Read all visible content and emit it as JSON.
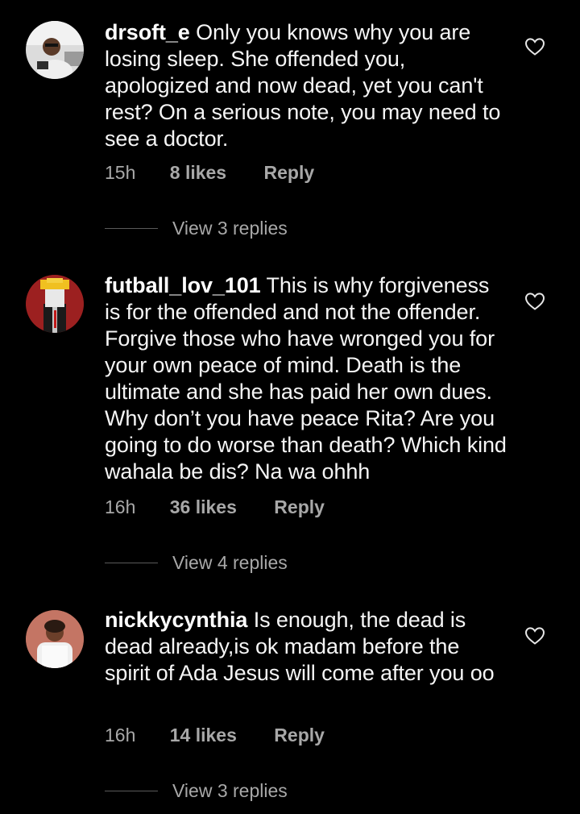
{
  "comments": [
    {
      "username": "drsoft_e",
      "text": "Only you knows why you are losing sleep. She offended you, apologized and now dead, yet you can't rest? On a serious note, you may need to see a doctor.",
      "time": "15h",
      "likes": "8 likes",
      "reply": "Reply",
      "view_replies": "View 3 replies"
    },
    {
      "username": "futball_lov_101",
      "text": "This is why forgiveness is for the offended and not the offender. Forgive those who have wronged you for your own peace of mind. Death is the ultimate and she has paid her own dues. Why don’t you have peace Rita? Are you going to do worse than death? Which kind wahala be dis? Na wa ohhh",
      "time": "16h",
      "likes": "36 likes",
      "reply": "Reply",
      "view_replies": "View 4 replies"
    },
    {
      "username": "nickkycynthia",
      "text": "Is enough, the dead is dead already,is ok madam before the spirit of Ada Jesus will come after you oo",
      "time": "16h",
      "likes": "14 likes",
      "reply": "Reply",
      "view_replies": "View 3 replies"
    }
  ],
  "colors": {
    "background": "#000000",
    "text": "#f5f5f5",
    "secondary": "#a8a8a8"
  },
  "icons": {
    "like": "heart-outline-icon"
  }
}
